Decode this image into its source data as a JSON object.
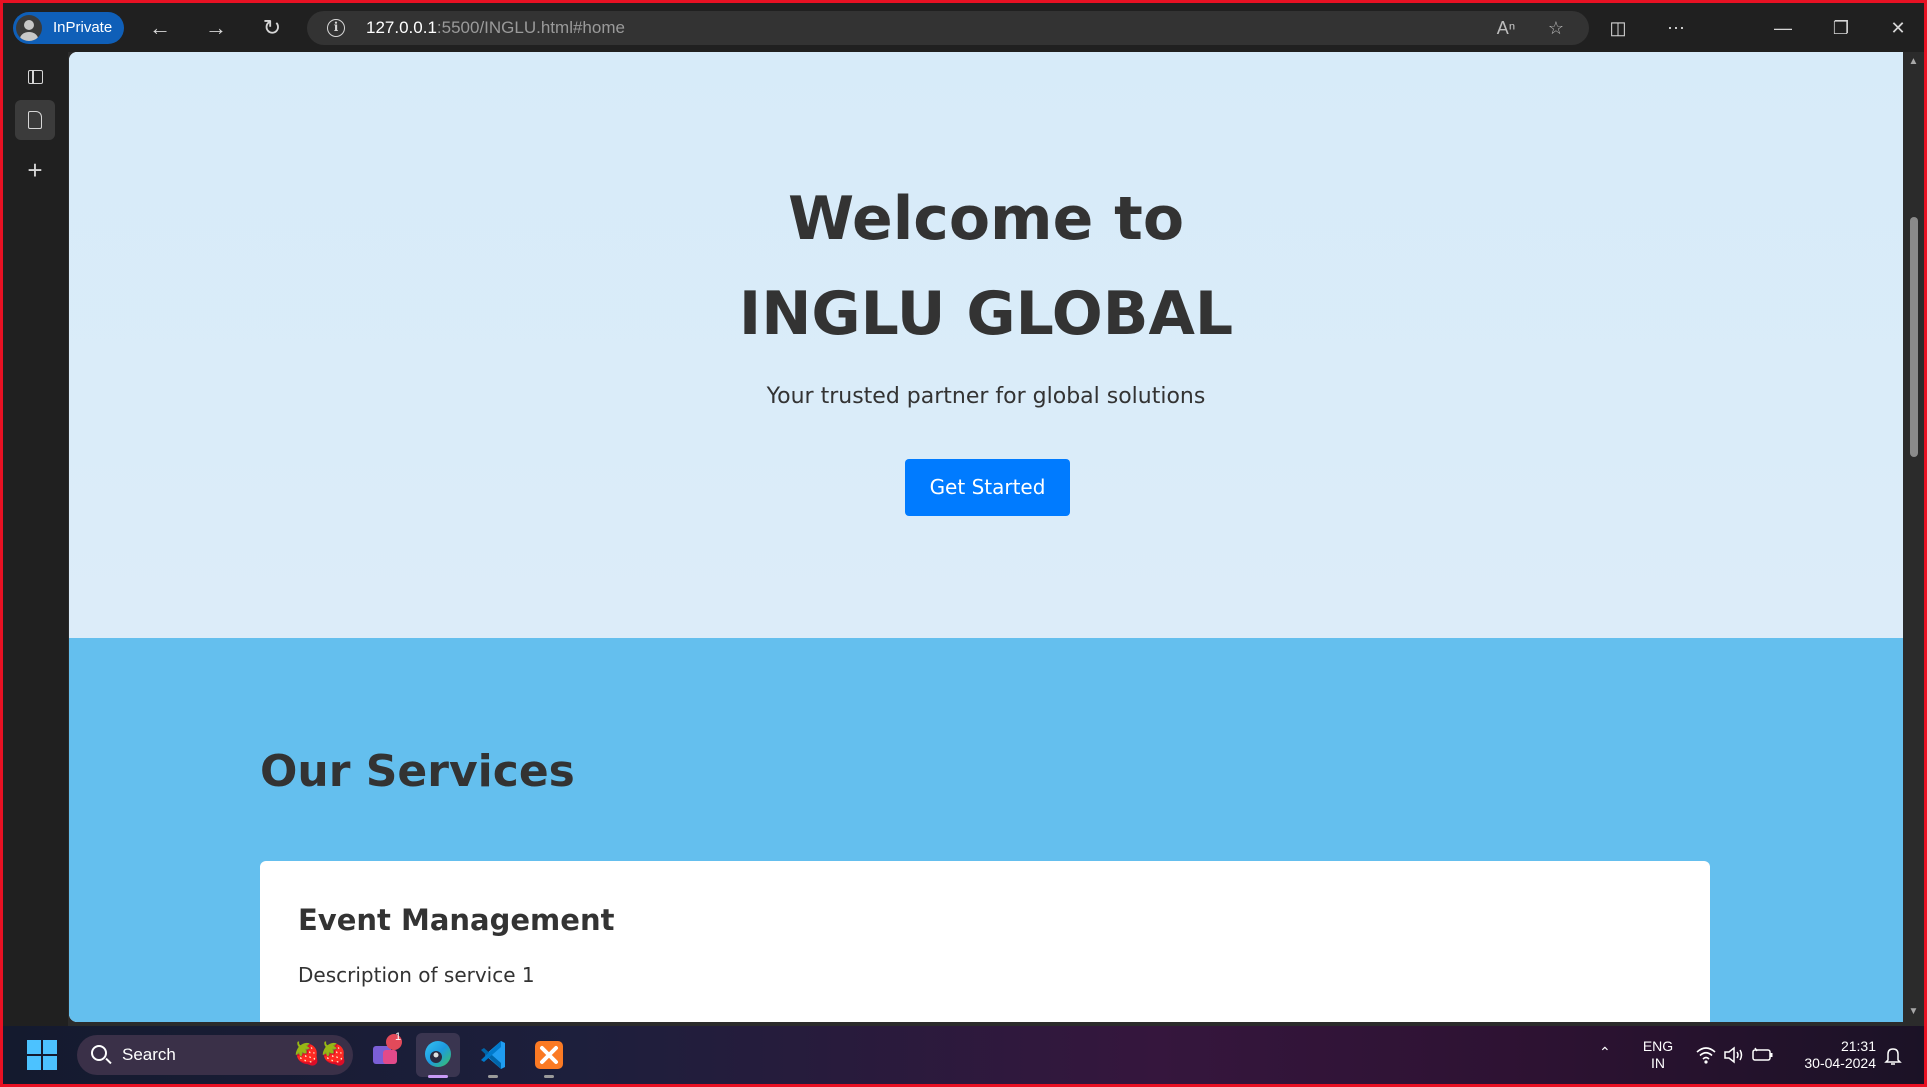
{
  "browser": {
    "profile_label": "InPrivate",
    "url_host": "127.0.0.1",
    "url_rest": ":5500/INGLU.html#home"
  },
  "page": {
    "hero": {
      "title": "Welcome to INGLU GLOBAL",
      "subtitle": "Your trusted partner for global solutions",
      "cta_label": "Get Started"
    },
    "services": {
      "title": "Our Services",
      "cards": [
        {
          "title": "Event Management",
          "description": "Description of service 1"
        }
      ]
    }
  },
  "taskbar": {
    "search_placeholder": "Search",
    "notification_count": "1",
    "lang_line1": "ENG",
    "lang_line2": "IN",
    "time": "21:31",
    "date": "30-04-2024"
  },
  "colors": {
    "hero_bg": "#d8ebf9",
    "services_bg": "#64bfee",
    "cta_bg": "#007bff",
    "window_border": "#e81123"
  }
}
